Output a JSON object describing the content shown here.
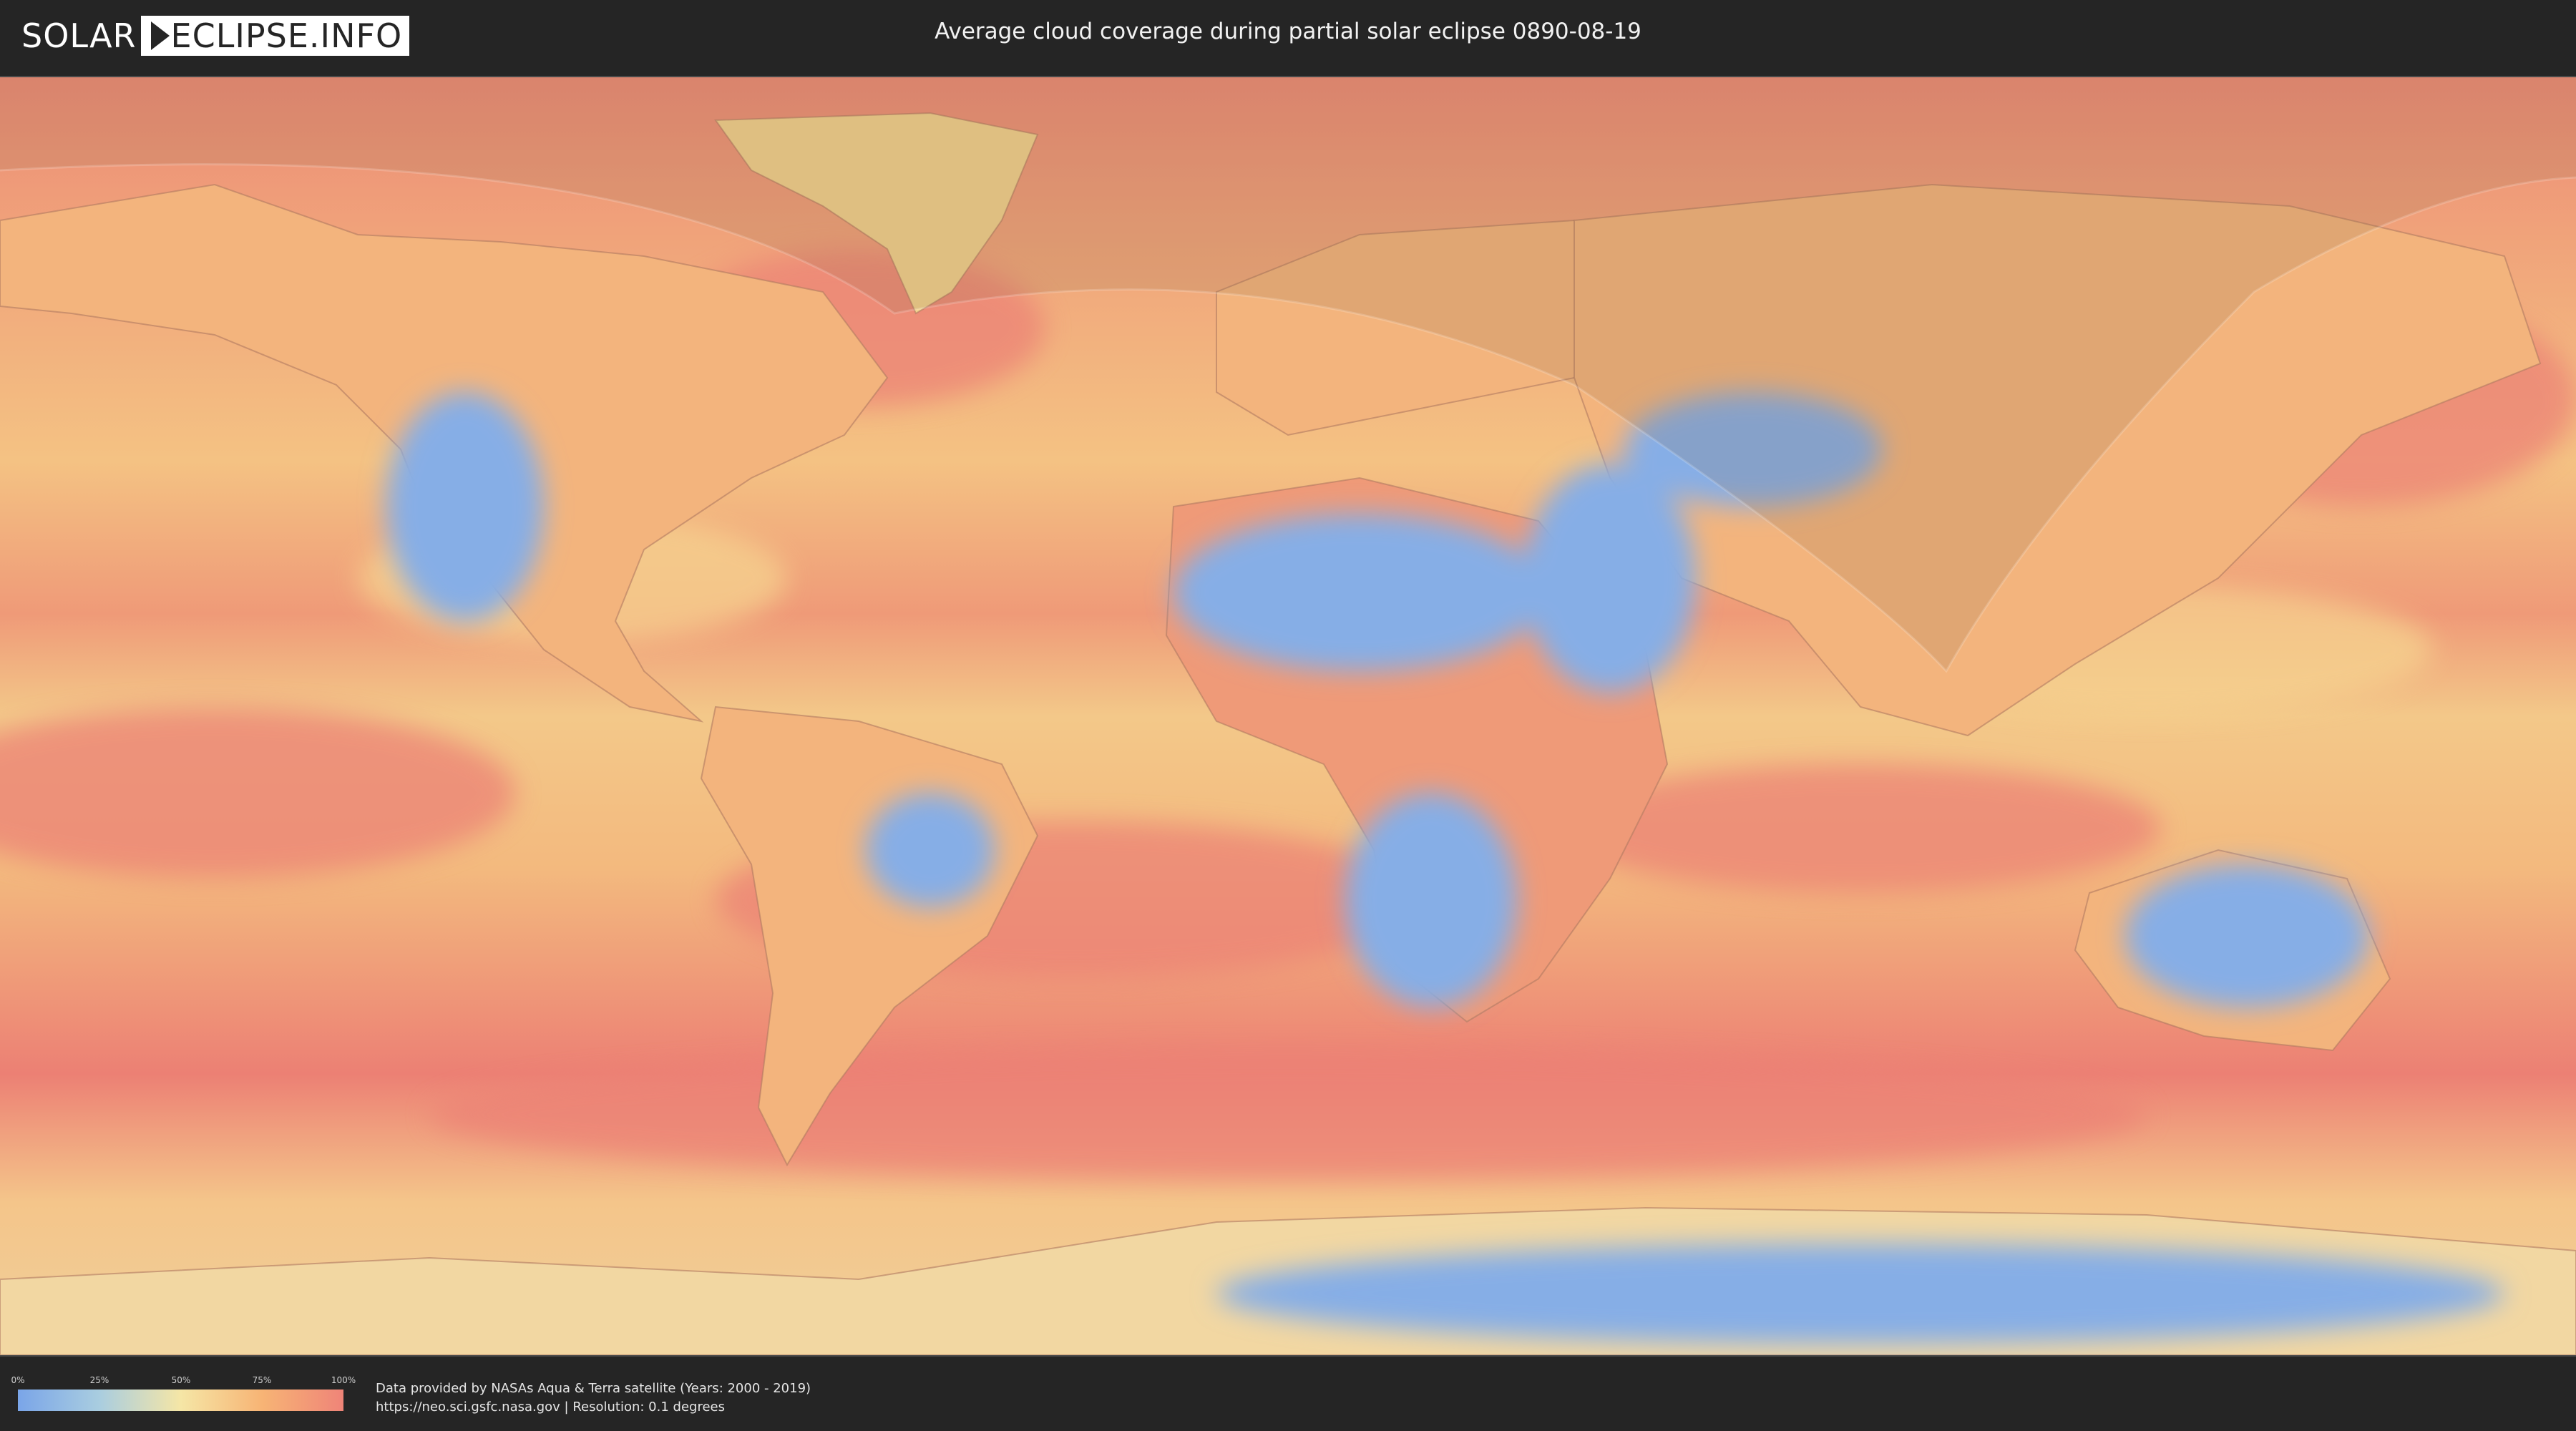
{
  "header": {
    "logo_left": "SOLAR",
    "logo_right": "ECLIPSE.INFO",
    "title": "Average cloud coverage during partial solar eclipse 0890-08-19"
  },
  "legend": {
    "ticks": [
      "0%",
      "25%",
      "50%",
      "75%",
      "100%"
    ],
    "colors": [
      "#7aa5e8",
      "#a9cde0",
      "#f5e6a6",
      "#f7b475",
      "#ef8478"
    ]
  },
  "footer": {
    "credit_line1": "Data provided by NASAs Aqua & Terra satellite (Years: 2000 - 2019)",
    "credit_line2": "https://neo.sci.gsfc.nasa.gov | Resolution: 0.1 degrees"
  },
  "map": {
    "base_color": "#f2a878",
    "cloudy_color": "#ec8276",
    "clear_color": "#86aee6",
    "shadow_color": "#8a6a4a"
  }
}
